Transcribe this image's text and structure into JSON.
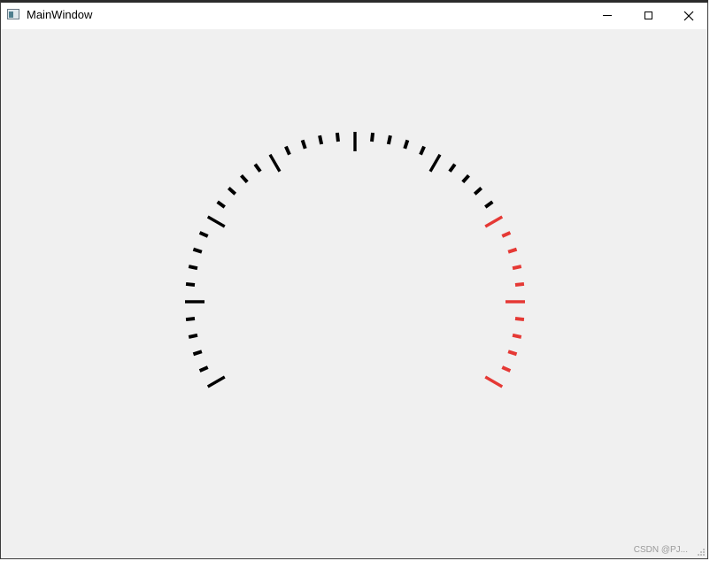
{
  "window": {
    "title": "MainWindow",
    "icon": "app-window-icon",
    "controls": [
      "minimize-icon",
      "maximize-icon",
      "close-icon"
    ]
  },
  "gauge": {
    "start_angle_deg": 210,
    "end_angle_deg": -30,
    "major_ticks": 9,
    "minor_per_major": 5,
    "red_from_fraction": 0.75,
    "colors": {
      "normal": "#000000",
      "warning": "#e53935"
    }
  },
  "watermark": "CSDN @PJ..."
}
